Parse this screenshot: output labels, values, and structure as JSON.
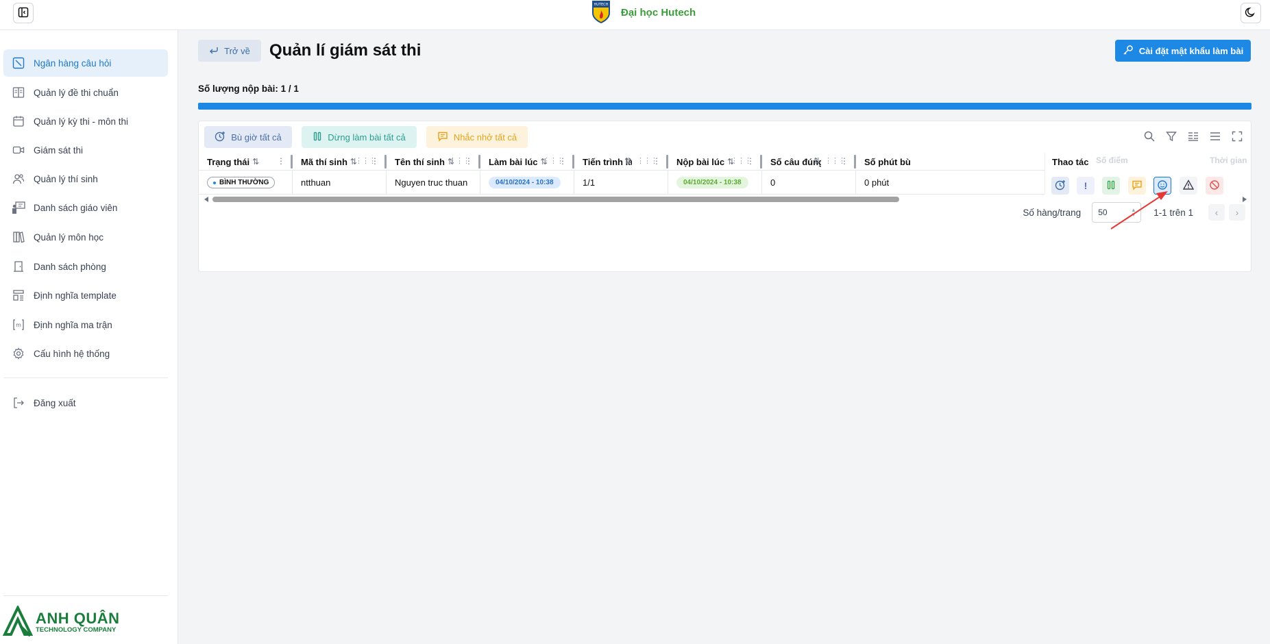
{
  "brand": {
    "name": "Đại học Hutech"
  },
  "sidebar": {
    "items": [
      {
        "label": "Ngân hàng câu hỏi",
        "icon": "question-bank-icon",
        "active": true
      },
      {
        "label": "Quản lý đề thi chuẩn",
        "icon": "book-open-icon"
      },
      {
        "label": "Quản lý kỳ thi - môn thi",
        "icon": "calendar-icon"
      },
      {
        "label": "Giám sát thi",
        "icon": "video-camera-icon"
      },
      {
        "label": "Quản lý thí sinh",
        "icon": "users-icon"
      },
      {
        "label": "Danh sách giáo viên",
        "icon": "teacher-board-icon"
      },
      {
        "label": "Quản lý môn học",
        "icon": "books-icon"
      },
      {
        "label": "Danh sách phòng",
        "icon": "door-icon"
      },
      {
        "label": "Định nghĩa template",
        "icon": "layout-template-icon"
      },
      {
        "label": "Định nghĩa ma trận",
        "icon": "matrix-brackets-icon"
      },
      {
        "label": "Cấu hình hệ thống",
        "icon": "gear-icon"
      }
    ],
    "logout": "Đăng xuất",
    "company": {
      "name": "ANH QUÂN",
      "tagline": "TECHNOLOGY COMPANY"
    }
  },
  "header": {
    "back_label": "Trở về",
    "title": "Quản lí giám sát thi",
    "password_button": "Cài đặt mật khẩu làm bài"
  },
  "submission": {
    "label": "Số lượng nộp bài: 1 / 1",
    "progress": 1.0
  },
  "toolbar": {
    "add_time_all": "Bù giờ tất cả",
    "pause_all": "Dừng làm bài tất cả",
    "remind_all": "Nhắc nhở tất cả"
  },
  "table": {
    "columns": [
      "Trạng thái",
      "Mã thí sinh",
      "Tên thí sinh",
      "Làm bài lúc",
      "Tiến trình làm bài",
      "Nộp bài lúc",
      "Số câu đúng",
      "Số phút bù",
      "Thao tác"
    ],
    "hidden_columns": [
      "Số điểm",
      "Thời gian"
    ],
    "rows": [
      {
        "status": "BÌNH THƯỜNG",
        "student_id": "ntthuan",
        "name": "Nguyen truc thuan",
        "started_at": "04/10/2024 - 10:38",
        "progress": "1/1",
        "submitted_at": "04/10/2024 - 10:38",
        "correct": "0",
        "extra_minutes": "0 phút"
      }
    ]
  },
  "pagination": {
    "rows_per_page_label": "Số hàng/trang",
    "rows_per_page": "50",
    "range": "1-1 trên 1"
  },
  "colors": {
    "primary": "#1e88e5",
    "brand_green": "#3a9d3a",
    "annotation_red": "#e53935"
  }
}
